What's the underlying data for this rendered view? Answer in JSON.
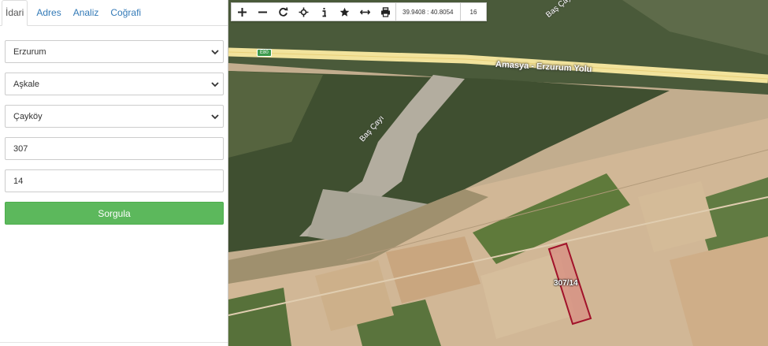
{
  "sidebar": {
    "tabs": [
      {
        "label": "İdari",
        "active": true
      },
      {
        "label": "Adres",
        "active": false
      },
      {
        "label": "Analiz",
        "active": false
      },
      {
        "label": "Coğrafi",
        "active": false
      }
    ],
    "province_select": "Erzurum",
    "district_select": "Aşkale",
    "neighborhood_select": "Çayköy",
    "block_input": "307",
    "parcel_input": "14",
    "query_button": "Sorgula"
  },
  "map": {
    "coordinate_readout": "39.9408 : 40.8054",
    "zoom_level": "16",
    "road_label": "Amasya - Erzurum Yolu",
    "road_shield": "E80",
    "river_label": "Baş Çayı",
    "parcel_label": "307/14",
    "colors": {
      "parcel_stroke": "#a1122a",
      "parcel_fill": "#d98a80",
      "button_green": "#5cb85c",
      "tab_link": "#337ab7"
    }
  },
  "icons": [
    "zoom-in-icon",
    "zoom-out-icon",
    "refresh-icon",
    "pan-icon",
    "info-icon",
    "favorite-icon",
    "measure-icon",
    "print-icon",
    "chevron-down-icon"
  ]
}
